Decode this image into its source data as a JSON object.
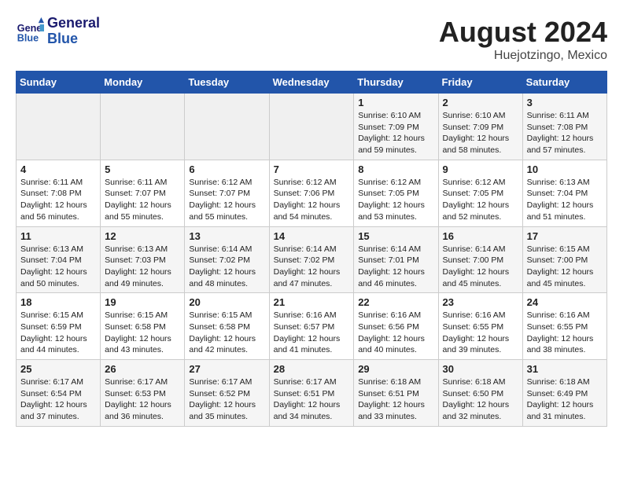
{
  "header": {
    "logo_line1": "General",
    "logo_line2": "Blue",
    "month_year": "August 2024",
    "location": "Huejotzingo, Mexico"
  },
  "days_of_week": [
    "Sunday",
    "Monday",
    "Tuesday",
    "Wednesday",
    "Thursday",
    "Friday",
    "Saturday"
  ],
  "weeks": [
    [
      {
        "day": "",
        "info": ""
      },
      {
        "day": "",
        "info": ""
      },
      {
        "day": "",
        "info": ""
      },
      {
        "day": "",
        "info": ""
      },
      {
        "day": "1",
        "info": "Sunrise: 6:10 AM\nSunset: 7:09 PM\nDaylight: 12 hours\nand 59 minutes."
      },
      {
        "day": "2",
        "info": "Sunrise: 6:10 AM\nSunset: 7:09 PM\nDaylight: 12 hours\nand 58 minutes."
      },
      {
        "day": "3",
        "info": "Sunrise: 6:11 AM\nSunset: 7:08 PM\nDaylight: 12 hours\nand 57 minutes."
      }
    ],
    [
      {
        "day": "4",
        "info": "Sunrise: 6:11 AM\nSunset: 7:08 PM\nDaylight: 12 hours\nand 56 minutes."
      },
      {
        "day": "5",
        "info": "Sunrise: 6:11 AM\nSunset: 7:07 PM\nDaylight: 12 hours\nand 55 minutes."
      },
      {
        "day": "6",
        "info": "Sunrise: 6:12 AM\nSunset: 7:07 PM\nDaylight: 12 hours\nand 55 minutes."
      },
      {
        "day": "7",
        "info": "Sunrise: 6:12 AM\nSunset: 7:06 PM\nDaylight: 12 hours\nand 54 minutes."
      },
      {
        "day": "8",
        "info": "Sunrise: 6:12 AM\nSunset: 7:05 PM\nDaylight: 12 hours\nand 53 minutes."
      },
      {
        "day": "9",
        "info": "Sunrise: 6:12 AM\nSunset: 7:05 PM\nDaylight: 12 hours\nand 52 minutes."
      },
      {
        "day": "10",
        "info": "Sunrise: 6:13 AM\nSunset: 7:04 PM\nDaylight: 12 hours\nand 51 minutes."
      }
    ],
    [
      {
        "day": "11",
        "info": "Sunrise: 6:13 AM\nSunset: 7:04 PM\nDaylight: 12 hours\nand 50 minutes."
      },
      {
        "day": "12",
        "info": "Sunrise: 6:13 AM\nSunset: 7:03 PM\nDaylight: 12 hours\nand 49 minutes."
      },
      {
        "day": "13",
        "info": "Sunrise: 6:14 AM\nSunset: 7:02 PM\nDaylight: 12 hours\nand 48 minutes."
      },
      {
        "day": "14",
        "info": "Sunrise: 6:14 AM\nSunset: 7:02 PM\nDaylight: 12 hours\nand 47 minutes."
      },
      {
        "day": "15",
        "info": "Sunrise: 6:14 AM\nSunset: 7:01 PM\nDaylight: 12 hours\nand 46 minutes."
      },
      {
        "day": "16",
        "info": "Sunrise: 6:14 AM\nSunset: 7:00 PM\nDaylight: 12 hours\nand 45 minutes."
      },
      {
        "day": "17",
        "info": "Sunrise: 6:15 AM\nSunset: 7:00 PM\nDaylight: 12 hours\nand 45 minutes."
      }
    ],
    [
      {
        "day": "18",
        "info": "Sunrise: 6:15 AM\nSunset: 6:59 PM\nDaylight: 12 hours\nand 44 minutes."
      },
      {
        "day": "19",
        "info": "Sunrise: 6:15 AM\nSunset: 6:58 PM\nDaylight: 12 hours\nand 43 minutes."
      },
      {
        "day": "20",
        "info": "Sunrise: 6:15 AM\nSunset: 6:58 PM\nDaylight: 12 hours\nand 42 minutes."
      },
      {
        "day": "21",
        "info": "Sunrise: 6:16 AM\nSunset: 6:57 PM\nDaylight: 12 hours\nand 41 minutes."
      },
      {
        "day": "22",
        "info": "Sunrise: 6:16 AM\nSunset: 6:56 PM\nDaylight: 12 hours\nand 40 minutes."
      },
      {
        "day": "23",
        "info": "Sunrise: 6:16 AM\nSunset: 6:55 PM\nDaylight: 12 hours\nand 39 minutes."
      },
      {
        "day": "24",
        "info": "Sunrise: 6:16 AM\nSunset: 6:55 PM\nDaylight: 12 hours\nand 38 minutes."
      }
    ],
    [
      {
        "day": "25",
        "info": "Sunrise: 6:17 AM\nSunset: 6:54 PM\nDaylight: 12 hours\nand 37 minutes."
      },
      {
        "day": "26",
        "info": "Sunrise: 6:17 AM\nSunset: 6:53 PM\nDaylight: 12 hours\nand 36 minutes."
      },
      {
        "day": "27",
        "info": "Sunrise: 6:17 AM\nSunset: 6:52 PM\nDaylight: 12 hours\nand 35 minutes."
      },
      {
        "day": "28",
        "info": "Sunrise: 6:17 AM\nSunset: 6:51 PM\nDaylight: 12 hours\nand 34 minutes."
      },
      {
        "day": "29",
        "info": "Sunrise: 6:18 AM\nSunset: 6:51 PM\nDaylight: 12 hours\nand 33 minutes."
      },
      {
        "day": "30",
        "info": "Sunrise: 6:18 AM\nSunset: 6:50 PM\nDaylight: 12 hours\nand 32 minutes."
      },
      {
        "day": "31",
        "info": "Sunrise: 6:18 AM\nSunset: 6:49 PM\nDaylight: 12 hours\nand 31 minutes."
      }
    ]
  ]
}
